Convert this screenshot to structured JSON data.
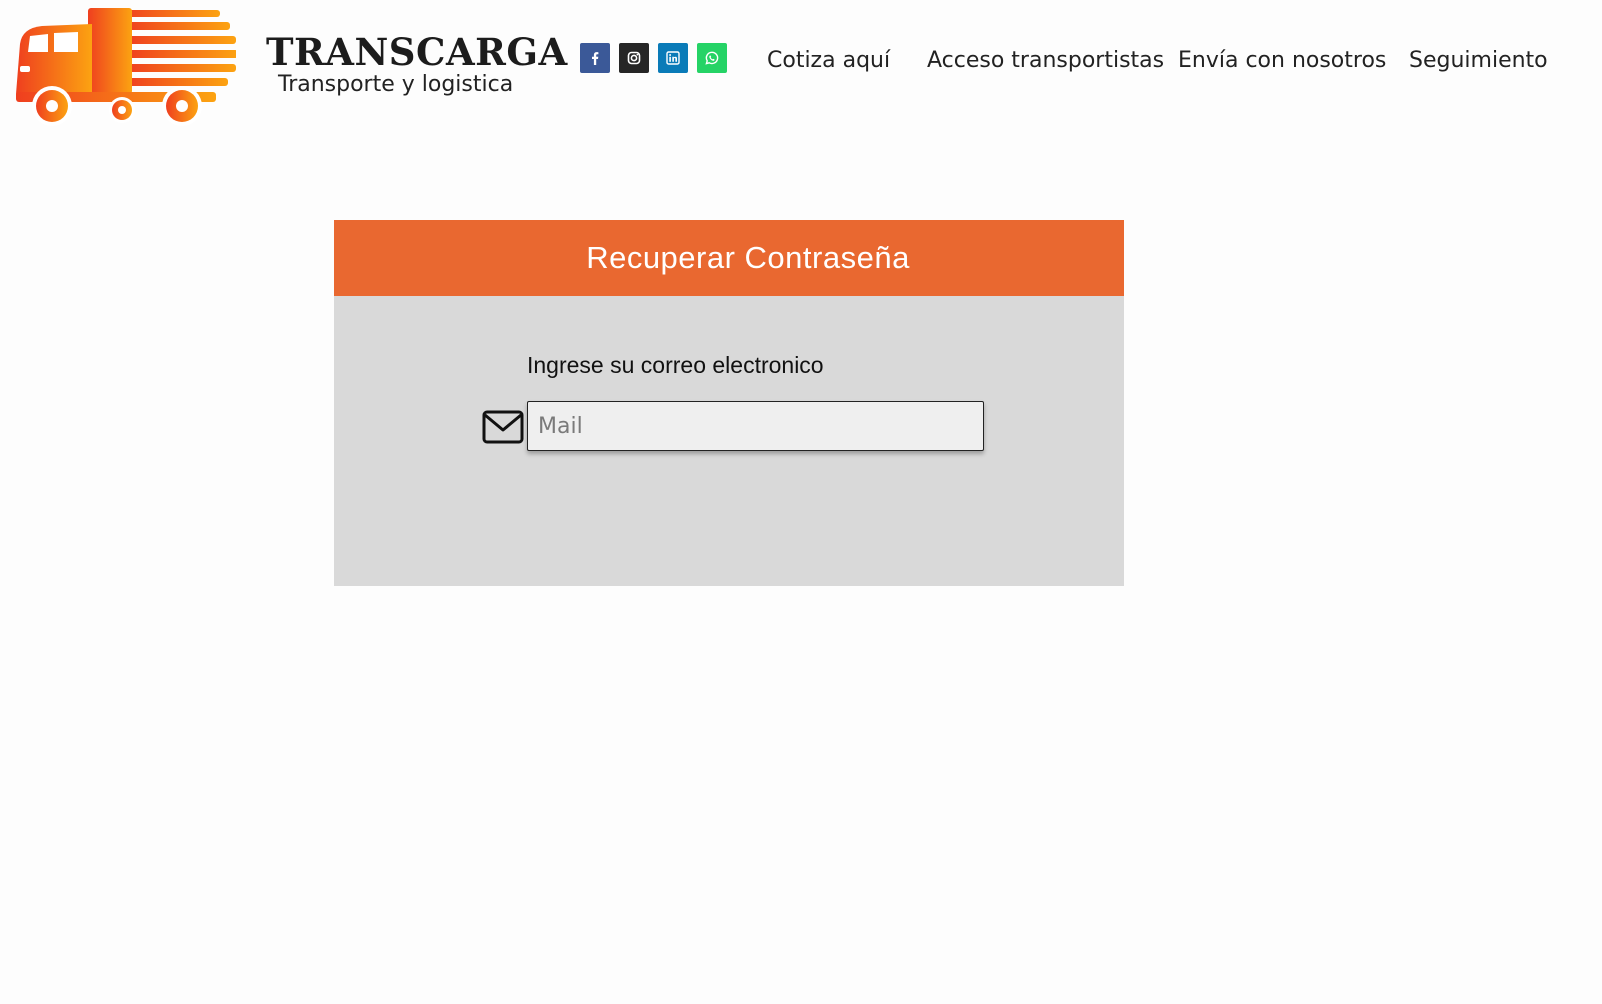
{
  "header": {
    "brand_name": "TRANSCARGA",
    "tagline": "Transporte y logistica",
    "logo_icon": "orange-delivery-truck-icon",
    "social": [
      {
        "name": "facebook-icon",
        "color": "#3b5998"
      },
      {
        "name": "instagram-icon",
        "color": "#262626"
      },
      {
        "name": "linkedin-icon",
        "color": "#0a7bb8"
      },
      {
        "name": "whatsapp-icon",
        "color": "#25d366"
      }
    ],
    "nav": [
      {
        "label": "Cotiza aquí"
      },
      {
        "label": "Acceso transportistas"
      },
      {
        "label": "Envía con nosotros"
      },
      {
        "label": "Seguimiento"
      }
    ]
  },
  "recovery": {
    "title": "Recuperar Contraseña",
    "label": "Ingrese su correo electronico",
    "input_icon": "envelope-icon",
    "input_placeholder": "Mail",
    "input_value": ""
  },
  "colors": {
    "accent": "#e96830",
    "panel_background": "#d9d9d9",
    "logo_gradient_start": "#ef3f1f",
    "logo_gradient_end": "#fca311"
  }
}
